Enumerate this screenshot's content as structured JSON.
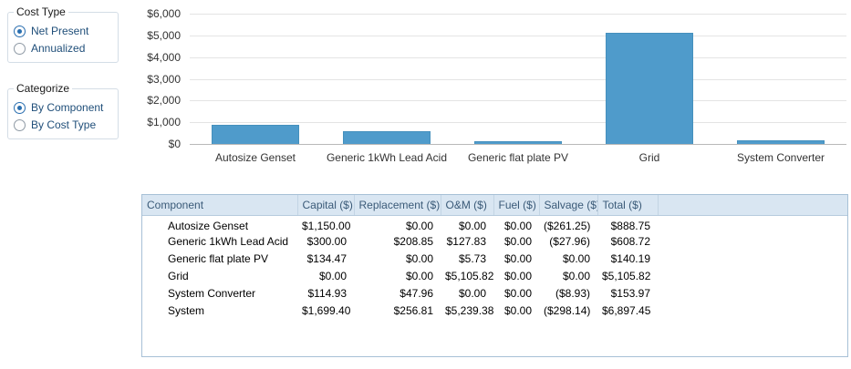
{
  "sidebar": {
    "cost_type": {
      "legend": "Cost Type",
      "options": [
        {
          "label": "Net Present",
          "selected": true
        },
        {
          "label": "Annualized",
          "selected": false
        }
      ]
    },
    "categorize": {
      "legend": "Categorize",
      "options": [
        {
          "label": "By Component",
          "selected": true
        },
        {
          "label": "By Cost Type",
          "selected": false
        }
      ]
    }
  },
  "chart_data": {
    "type": "bar",
    "categories": [
      "Autosize Genset",
      "Generic 1kWh Lead Acid",
      "Generic flat plate PV",
      "Grid",
      "System Converter"
    ],
    "values": [
      888.75,
      608.72,
      140.19,
      5105.82,
      153.97
    ],
    "ylim": [
      0,
      6000
    ],
    "ytick_interval": 1000,
    "ytick_labels": [
      "$0",
      "$1,000",
      "$2,000",
      "$3,000",
      "$4,000",
      "$5,000",
      "$6,000"
    ],
    "bar_color": "#4f9bcb",
    "grid": true,
    "legend_position": "none"
  },
  "table": {
    "columns": [
      "Component",
      "Capital ($)",
      "Replacement ($)",
      "O&M ($)",
      "Fuel ($)",
      "Salvage ($)",
      "Total ($)"
    ],
    "rows": [
      [
        "Autosize Genset",
        "$1,150.00",
        "$0.00",
        "$0.00",
        "$0.00",
        "($261.25)",
        "$888.75"
      ],
      [
        "Generic 1kWh Lead Acid",
        "$300.00",
        "$208.85",
        "$127.83",
        "$0.00",
        "($27.96)",
        "$608.72"
      ],
      [
        "Generic flat plate PV",
        "$134.47",
        "$0.00",
        "$5.73",
        "$0.00",
        "$0.00",
        "$140.19"
      ],
      [
        "Grid",
        "$0.00",
        "$0.00",
        "$5,105.82",
        "$0.00",
        "$0.00",
        "$5,105.82"
      ],
      [
        "System Converter",
        "$114.93",
        "$47.96",
        "$0.00",
        "$0.00",
        "($8.93)",
        "$153.97"
      ],
      [
        "System",
        "$1,699.40",
        "$256.81",
        "$5,239.38",
        "$0.00",
        "($298.14)",
        "$6,897.45"
      ]
    ]
  },
  "colors": {
    "bar_fill": "#4f9bcb",
    "table_header_bg": "#d9e6f2",
    "radio_accent": "#2a6fb0"
  }
}
